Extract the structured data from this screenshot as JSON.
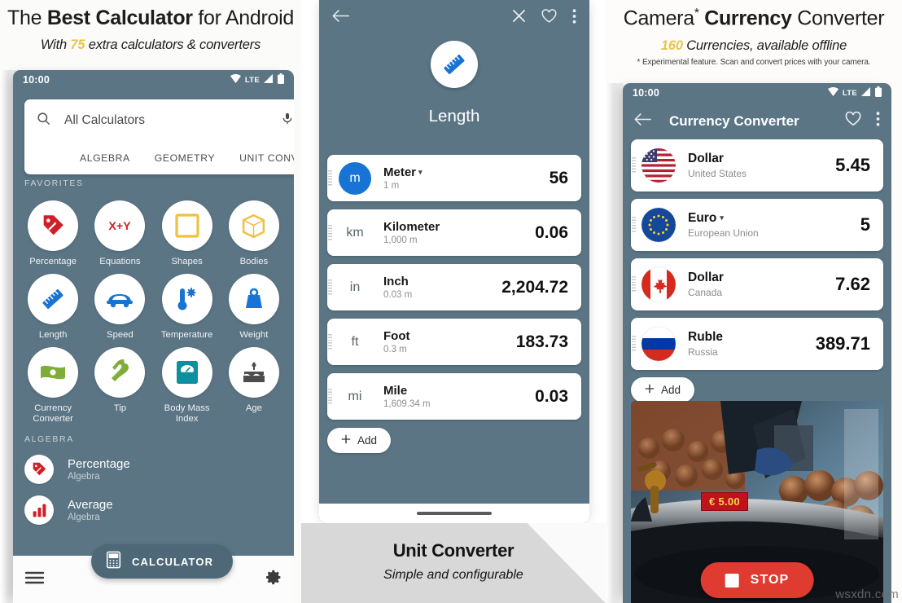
{
  "left_panel": {
    "heading_pre": "The ",
    "heading_bold": "Best Calculator",
    "heading_post": " for Android",
    "sub_pre": "With ",
    "sub_num": "75",
    "sub_post": " extra calculators & converters",
    "status": {
      "time": "10:00",
      "network": "LTE"
    },
    "search": {
      "placeholder": "All Calculators",
      "mic_icon": "microphone-icon",
      "search_icon": "search-icon"
    },
    "tabs": [
      "ALGEBRA",
      "GEOMETRY",
      "UNIT CONVERT"
    ],
    "favorites_label": "FAVORITES",
    "favorites": [
      {
        "label": "Percentage",
        "icon": "price-tag-icon",
        "color": "#cf2027"
      },
      {
        "label": "Equations",
        "icon": "x-plus-y-icon",
        "color": "#cf2027"
      },
      {
        "label": "Shapes",
        "icon": "square-outline-icon",
        "color": "#edc141"
      },
      {
        "label": "Bodies",
        "icon": "cube-icon",
        "color": "#edc141"
      },
      {
        "label": "Length",
        "icon": "ruler-icon",
        "color": "#1773d4"
      },
      {
        "label": "Speed",
        "icon": "car-icon",
        "color": "#1773d4"
      },
      {
        "label": "Temperature",
        "icon": "thermometer-icon",
        "color": "#1773d4"
      },
      {
        "label": "Weight",
        "icon": "weight-icon",
        "color": "#1773d4"
      },
      {
        "label": "Currency Converter",
        "icon": "banknote-icon",
        "color": "#7fae38"
      },
      {
        "label": "Tip",
        "icon": "tip-hand-icon",
        "color": "#7fae38"
      },
      {
        "label": "Body Mass Index",
        "icon": "scale-icon",
        "color": "#0d8f9e"
      },
      {
        "label": "Age",
        "icon": "birthday-cake-icon",
        "color": "#4d4d4d"
      }
    ],
    "algebra_label": "ALGEBRA",
    "algebra_items": [
      {
        "title": "Percentage",
        "sub": "Algebra",
        "icon": "price-tag-icon"
      },
      {
        "title": "Average",
        "sub": "Algebra",
        "icon": "bar-chart-icon"
      }
    ],
    "fab": {
      "label": "CALCULATOR",
      "icon": "calculator-icon"
    },
    "bottom": {
      "menu_icon": "hamburger-menu-icon",
      "settings_icon": "gear-icon"
    }
  },
  "mid_panel": {
    "appbar": {
      "back_icon": "back-arrow-icon",
      "close_icon": "close-icon",
      "favorite_icon": "heart-icon",
      "overflow_icon": "more-vertical-icon"
    },
    "hero": {
      "icon": "ruler-icon",
      "title": "Length"
    },
    "units": [
      {
        "badge": "m",
        "name": "Meter",
        "has_caret": true,
        "sub": "1 m",
        "value": "56",
        "active": true
      },
      {
        "badge": "km",
        "name": "Kilometer",
        "has_caret": false,
        "sub": "1,000 m",
        "value": "0.06",
        "active": false
      },
      {
        "badge": "in",
        "name": "Inch",
        "has_caret": false,
        "sub": "0.03 m",
        "value": "2,204.72",
        "active": false
      },
      {
        "badge": "ft",
        "name": "Foot",
        "has_caret": false,
        "sub": "0.3 m",
        "value": "183.73",
        "active": false
      },
      {
        "badge": "mi",
        "name": "Mile",
        "has_caret": false,
        "sub": "1,609.34 m",
        "value": "0.03",
        "active": false
      }
    ],
    "add_label": "Add",
    "footer": {
      "title": "Unit Converter",
      "sub": "Simple and configurable"
    }
  },
  "right_panel": {
    "heading_pre": "Camera",
    "heading_star": "*",
    "heading_bold": "Currency",
    "heading_post": " Converter",
    "sub_num": "160",
    "sub_post": " Currencies, available offline",
    "footnote": "* Experimental feature. Scan and convert prices with your camera.",
    "status": {
      "time": "10:00",
      "network": "LTE"
    },
    "appbar": {
      "back_icon": "back-arrow-icon",
      "title": "Currency Converter",
      "favorite_icon": "heart-icon",
      "overflow_icon": "more-vertical-icon"
    },
    "currencies": [
      {
        "name": "Dollar",
        "country": "United States",
        "value": "5.45",
        "flag": "flag-us",
        "has_caret": false
      },
      {
        "name": "Euro",
        "country": "European Union",
        "value": "5",
        "flag": "flag-eu",
        "has_caret": true
      },
      {
        "name": "Dollar",
        "country": "Canada",
        "value": "7.62",
        "flag": "flag-canada",
        "has_caret": false
      },
      {
        "name": "Ruble",
        "country": "Russia",
        "value": "389.71",
        "flag": "flag-russia",
        "has_caret": false
      }
    ],
    "add_label": "Add",
    "camera": {
      "price_tag": "€ 5.00",
      "stop_label": "STOP",
      "stop_icon": "stop-square-icon"
    }
  },
  "watermark": "wsxdn.com"
}
